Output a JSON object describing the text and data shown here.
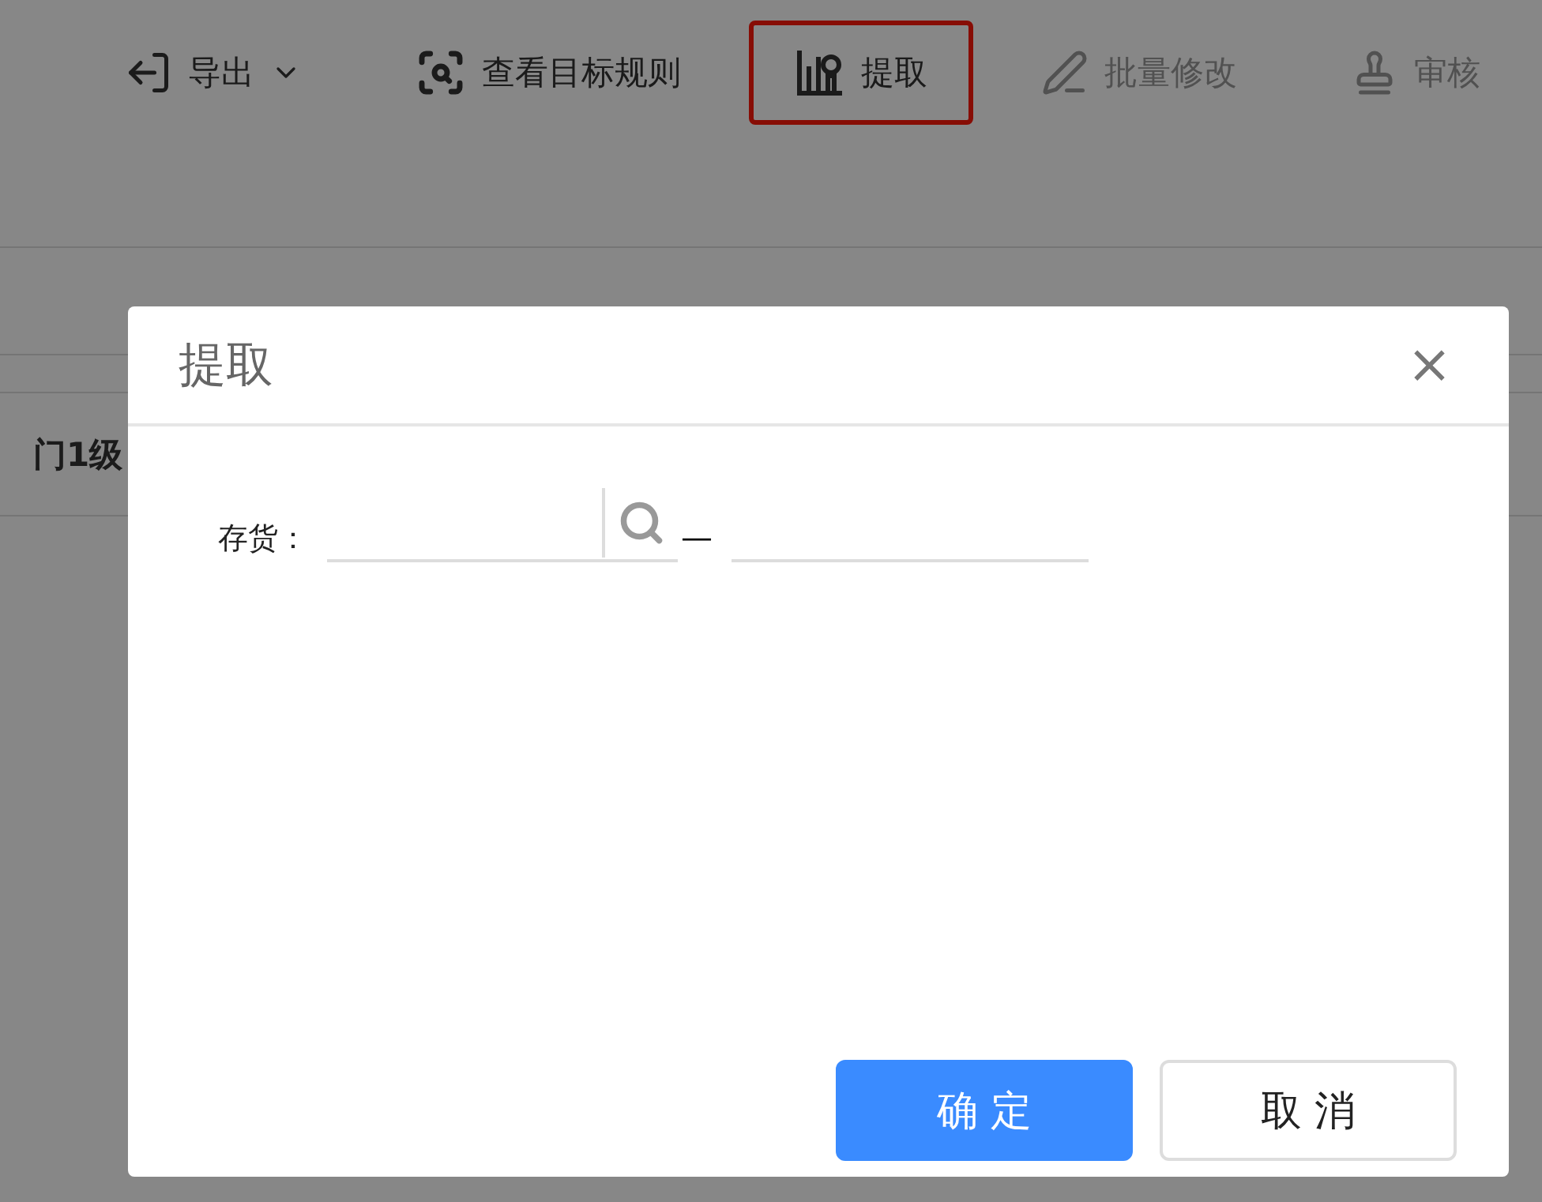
{
  "toolbar": [
    {
      "label": "导出",
      "dropdown": true,
      "disabled": false,
      "highlighted": false
    },
    {
      "label": "查看目标规则",
      "dropdown": false,
      "disabled": false,
      "highlighted": false
    },
    {
      "label": "提取",
      "dropdown": false,
      "disabled": false,
      "highlighted": true
    },
    {
      "label": "批量修改",
      "dropdown": false,
      "disabled": true,
      "highlighted": false
    },
    {
      "label": "审核",
      "dropdown": false,
      "disabled": true,
      "highlighted": false
    }
  ],
  "rows": [
    {
      "cells": [
        "门1级"
      ],
      "bold": true
    }
  ],
  "dialog": {
    "title": "提取",
    "close": "×",
    "field_label": "存货：",
    "separator": "—",
    "buttons": [
      {
        "label": "确 定",
        "primary": true
      },
      {
        "label": "取 消",
        "primary": false
      }
    ]
  }
}
